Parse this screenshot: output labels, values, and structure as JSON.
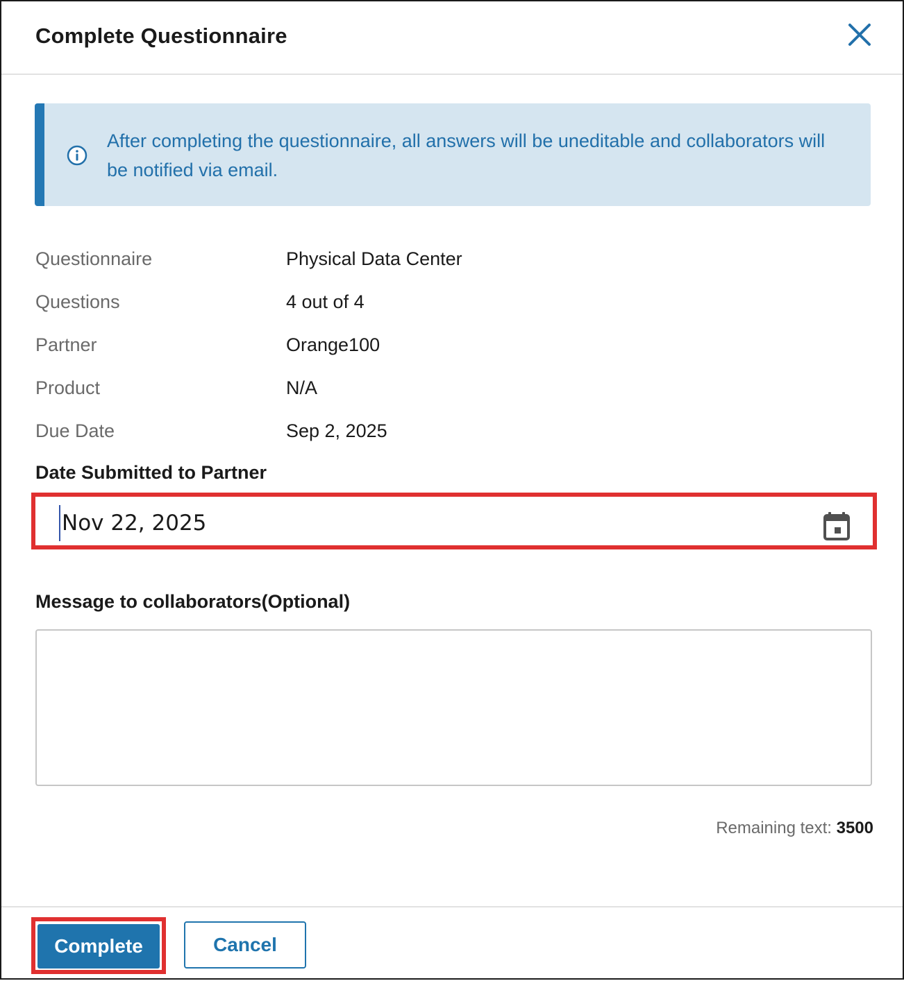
{
  "dialog": {
    "title": "Complete Questionnaire",
    "close_icon": "close-icon"
  },
  "info_banner": {
    "icon": "info-icon",
    "text": "After completing the questionnaire, all answers will be uneditable and collaborators will be notified via email.",
    "accent_color": "#2478b4",
    "background_color": "#d5e5f0"
  },
  "details": [
    {
      "label": "Questionnaire",
      "value": "Physical Data Center"
    },
    {
      "label": "Questions",
      "value": "4 out of 4"
    },
    {
      "label": "Partner",
      "value": "Orange100"
    },
    {
      "label": "Product",
      "value": "N/A"
    },
    {
      "label": "Due Date",
      "value": "Sep 2, 2025"
    }
  ],
  "date_submitted": {
    "label": "Date Submitted to Partner",
    "value": "Nov 22, 2025",
    "icon": "calendar-icon"
  },
  "message": {
    "label": "Message to collaborators(Optional)",
    "value": "",
    "remaining_label": "Remaining text:",
    "remaining_count": "3500"
  },
  "footer": {
    "complete_label": "Complete",
    "cancel_label": "Cancel",
    "primary_color": "#1f74ad"
  },
  "highlight_color": "#e03030"
}
